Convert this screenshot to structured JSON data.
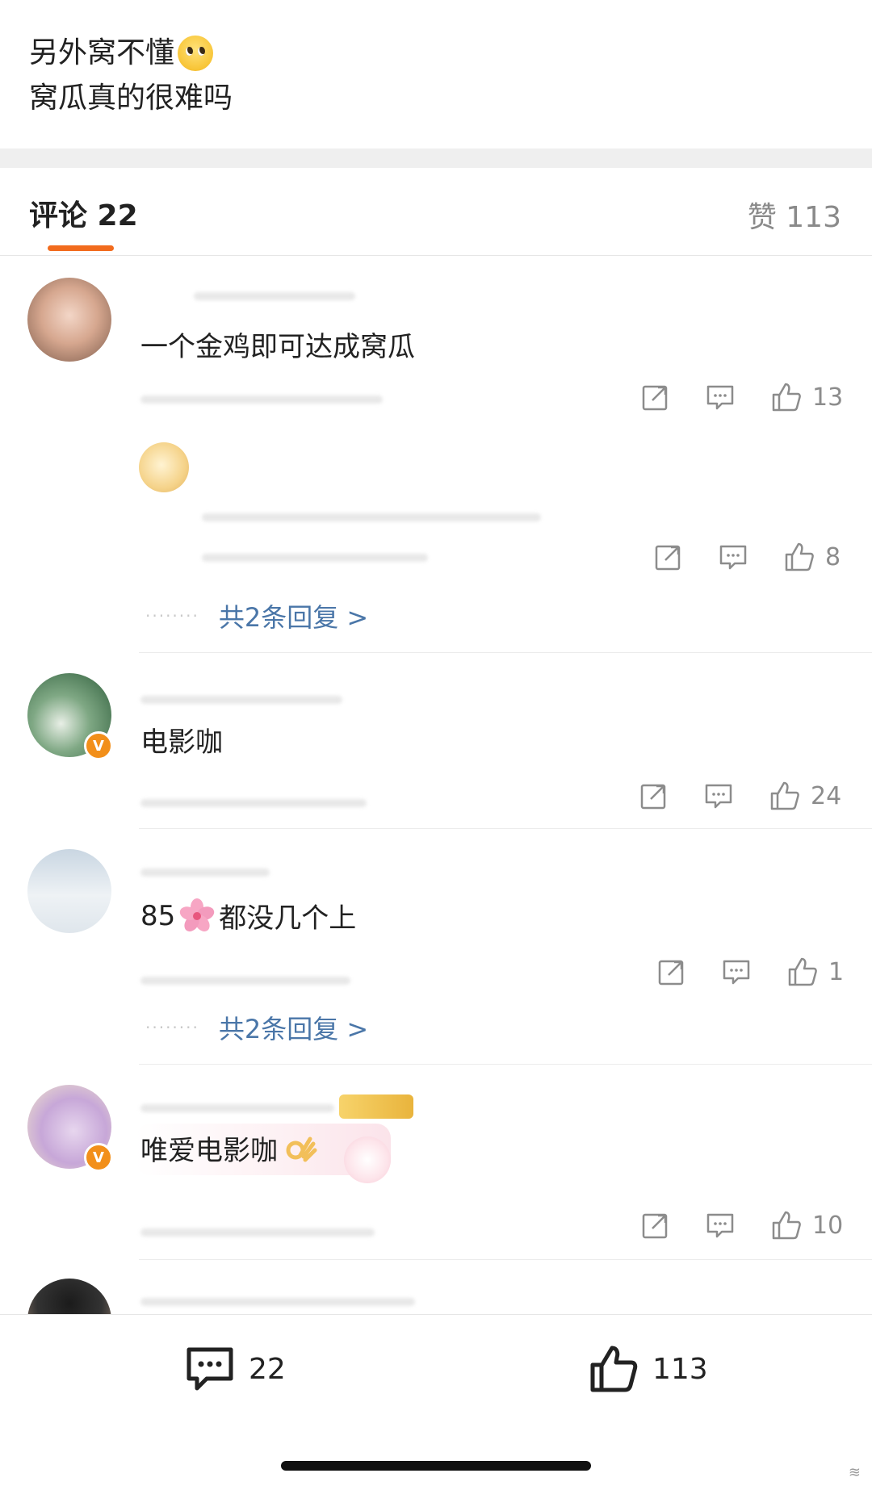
{
  "post": {
    "line1": "另外窝不懂",
    "line2": "窝瓜真的很难吗"
  },
  "tabs": {
    "comments_label": "评论 22",
    "likes_label": "赞 113"
  },
  "comments": [
    {
      "text": "一个金鸡即可达成窝瓜",
      "likes": "13"
    },
    {
      "text": "电影咖",
      "likes": "24"
    },
    {
      "text": "85",
      "text_after": "都没几个上",
      "likes": "1"
    },
    {
      "text": "唯爱电影咖",
      "likes": "10"
    }
  ],
  "replies": [
    {
      "likes": "8"
    }
  ],
  "more_replies": [
    "共2条回复 >",
    "共2条回复 >"
  ],
  "bottom_bar": {
    "comment_count": "22",
    "like_count": "113"
  },
  "colors": {
    "accent": "#f26b1d",
    "link": "#4a76a8",
    "muted": "#8c8c8c"
  },
  "icons": [
    "share-icon",
    "comment-icon",
    "like-icon",
    "sakura-emoji",
    "ok-hand-emoji",
    "vip-badge-icon"
  ]
}
